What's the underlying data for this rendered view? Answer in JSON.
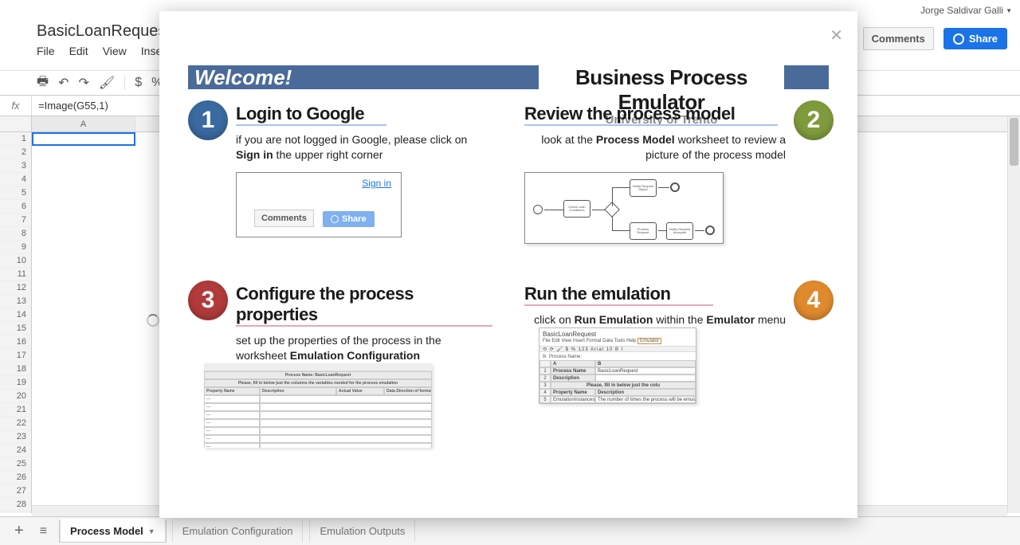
{
  "user_name": "Jorge Saldivar Galli",
  "doc_title": "BasicLoanReques",
  "menubar": [
    "File",
    "Edit",
    "View",
    "Inser"
  ],
  "comments_btn": "Comments",
  "share_btn": "Share",
  "toolbar_glyphs": [
    "$",
    "%"
  ],
  "fx_label": "fx",
  "formula": "=Image(G55,1)",
  "col_header": "A",
  "row_numbers": [
    1,
    2,
    3,
    4,
    5,
    6,
    7,
    8,
    9,
    10,
    11,
    12,
    13,
    14,
    15,
    16,
    17,
    18,
    19,
    20,
    21,
    22,
    23,
    24,
    25,
    26,
    27,
    28
  ],
  "sheet_tabs": {
    "active": "Process Model",
    "others": [
      "Emulation Configuration",
      "Emulation Outputs"
    ]
  },
  "modal": {
    "welcome": "Welcome!",
    "bpe_main": "Business Process Emulator",
    "bpe_sub": "University of Trento",
    "step1": {
      "num": "1",
      "title": "Login to Google",
      "text_a": "if you are not logged in Google, please click on ",
      "text_b": "Sign in",
      "text_c": " the upper right corner",
      "signin": "Sign in",
      "comments_mini": "Comments",
      "share_mini": "Share"
    },
    "step2": {
      "num": "2",
      "title": "Review the process model",
      "text_a": "look at the ",
      "text_b": "Process Model",
      "text_c": " worksheet to review a picture of the process model",
      "tasks": [
        "Check Loan Conditions",
        "Notify Request Reject",
        "Process Request",
        "Notify Request Accepted"
      ]
    },
    "step3": {
      "num": "3",
      "title": "Configure the process properties",
      "text_a": "set up the properties of the process in the worksheet ",
      "text_b": "Emulation Configuration",
      "table_banner": "Please, fill in below just the columns the variables needed for the process emulation",
      "hdr_prop": "Property Name",
      "hdr_desc": "Description",
      "hdr_act": "Actual Value",
      "hdr_dir": "Data Direction of formula",
      "process_name_row": "Process Name: BasicLoanRequest"
    },
    "step4": {
      "num": "4",
      "title": "Run the emulation",
      "text_a": "click on ",
      "text_b": "Run Emulation",
      "text_c": " within the ",
      "text_d": "Emulator",
      "text_e": " menu",
      "mini_title": "BasicLoanRequest",
      "mini_menus_a": "File  Edit  View  Insert  Format  Data  Tools  Help  ",
      "mini_emul": "Emulator",
      "fx": "fx",
      "pn_lbl": "Process Name:",
      "row_pn": "Process Name",
      "row_pn_val": "BasicLoanRequest",
      "row_desc": "Description",
      "row_banner": "Please, fill in below just the colu",
      "row_prop": "Property Name",
      "row_prop_desc": "Description",
      "row_inst": "EmulationInstances",
      "row_inst_desc": "The number of times the process will be emulat"
    }
  }
}
